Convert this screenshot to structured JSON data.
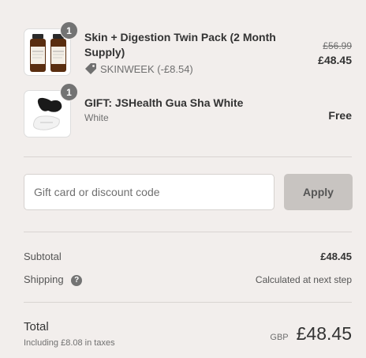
{
  "items": [
    {
      "quantity": "1",
      "title": "Skin + Digestion Twin Pack (2 Month Supply)",
      "discount_label": "SKINWEEK (-£8.54)",
      "original_price": "£56.99",
      "price": "£48.45",
      "icon": "bottle-pair-thumbnail"
    },
    {
      "quantity": "1",
      "title": "GIFT: JSHealth Gua Sha White",
      "variant": "White",
      "price": "Free",
      "icon": "gua-sha-thumbnail"
    }
  ],
  "discount_form": {
    "placeholder": "Gift card or discount code",
    "apply_label": "Apply"
  },
  "summary": {
    "subtotal_label": "Subtotal",
    "subtotal_value": "£48.45",
    "shipping_label": "Shipping",
    "shipping_value": "Calculated at next step",
    "total_label": "Total",
    "tax_note": "Including £8.08 in taxes",
    "currency": "GBP",
    "total_value": "£48.45"
  },
  "colors": {
    "background": "#f2eeec",
    "badge": "#737373",
    "apply_button": "#c8c4c1"
  }
}
